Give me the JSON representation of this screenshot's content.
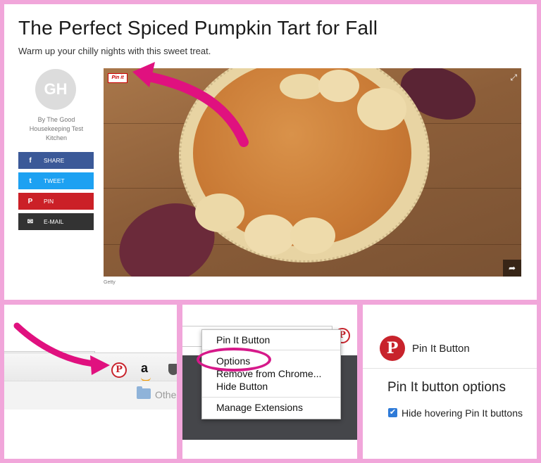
{
  "article": {
    "title": "The Perfect Spiced Pumpkin Tart for Fall",
    "subtitle": "Warm up your chilly nights with this sweet treat.",
    "avatar_initials": "GH",
    "byline": "By The Good Housekeeping Test Kitchen",
    "photo_credit": "Getty",
    "pin_it_badge": "Pin it",
    "share_buttons": [
      {
        "label": "SHARE",
        "icon": "facebook-icon",
        "glyph": "f",
        "color": "#3b5998"
      },
      {
        "label": "TWEET",
        "icon": "twitter-icon",
        "glyph": "t",
        "color": "#1da1f2"
      },
      {
        "label": "PIN",
        "icon": "pinterest-icon",
        "glyph": "P",
        "color": "#cb2027"
      },
      {
        "label": "E-MAIL",
        "icon": "email-icon",
        "glyph": "✉",
        "color": "#333333"
      }
    ]
  },
  "toolbar_panel": {
    "bookmark_folder_label": "Othe",
    "amazon_glyph": "a"
  },
  "context_menu": {
    "items": [
      "Pin It Button",
      "Options",
      "Remove from Chrome...",
      "Hide Button",
      "Manage Extensions"
    ]
  },
  "options_page": {
    "extension_name": "Pin It Button",
    "heading": "Pin It button options",
    "checkbox_label": "Hide hovering Pin It buttons",
    "checkbox_checked": true
  },
  "colors": {
    "page_background": "#f1a6da",
    "arrow": "#e0117f",
    "pinterest_red": "#c8232c"
  }
}
